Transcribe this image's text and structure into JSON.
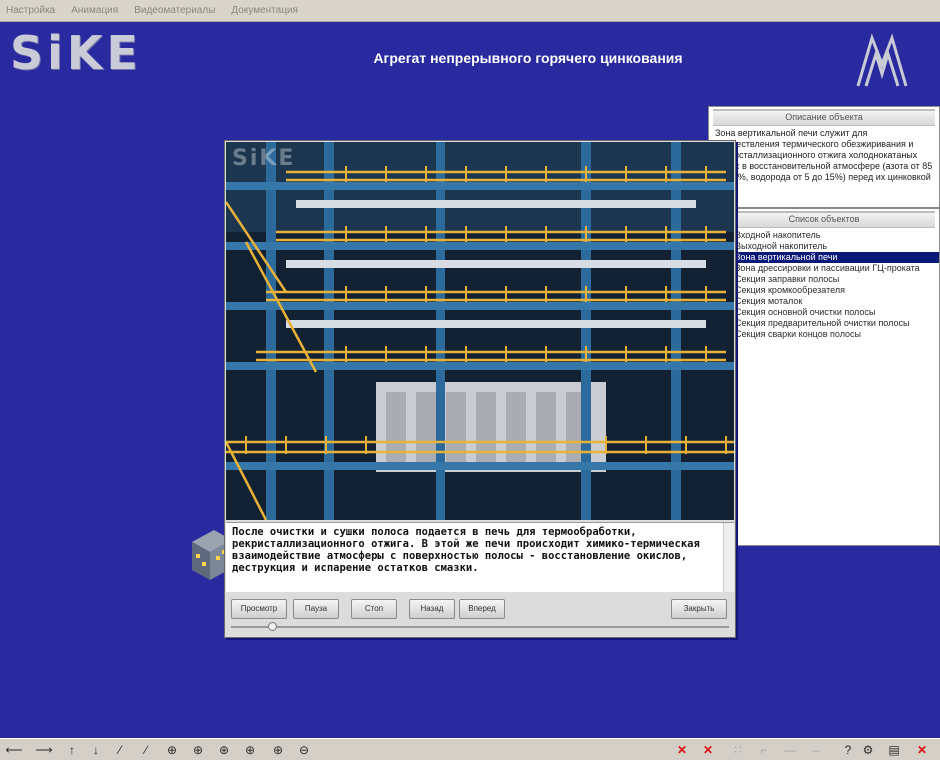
{
  "menu": [
    "Настройка",
    "Анимация",
    "Видеоматериалы",
    "Документация"
  ],
  "header": {
    "logo_text": "SiKE",
    "title": "Агрегат непрерывного горячего цинкования",
    "brand_mark": "MM"
  },
  "description_panel": {
    "title": "Описание объекта",
    "text": "Зона вертикальной печи служит для осуществления термического обезжиривания и рекристаллизационного отжига холоднокатаных полос в восстановительной атмосфере (азота от 85 до 95%, водорода от 5 до 15%) перед их цинковкой"
  },
  "objects_panel": {
    "title": "Список объектов",
    "items": [
      "Входной накопитель",
      "Выходной накопитель",
      "Зона вертикальной печи",
      "Зона дрессировки и пассивации ГЦ-проката",
      "Секция заправки полосы",
      "Секция кромкообрезателя",
      "Секция моталок",
      "Секция основной очистки полосы",
      "Секция предварительной очистки полосы",
      "Секция сварки концов полосы"
    ],
    "selected_index": 2
  },
  "viewer": {
    "watermark": "SiKE",
    "caption": "После очистки и сушки полоса подается в печь для термообработки, рекристаллизационного отжига. В этой же печи происходит химико-термическая взаимодействие атмосферы с поверхностью полосы - восстановление окислов, деструкция и испарение остатков смазки.",
    "buttons": {
      "view": "Просмотр",
      "pause": "Пауза",
      "stop": "Стоп",
      "back": "Назад",
      "forward": "Вперед",
      "close": "Закрыть"
    },
    "progress_fraction": 0.08
  },
  "toolbar": {
    "icons": [
      "arrow-left-icon",
      "arrow-right-icon",
      "arrow-up-icon",
      "arrow-down-icon",
      "diagonal-up-icon",
      "diagonal-down-icon",
      "rotate-x-icon",
      "rotate-y-icon",
      "rotate-z-icon",
      "rotate-free-icon",
      "zoom-in-icon",
      "zoom-out-icon",
      "remove-icon",
      "remove-all-icon",
      "grid-icon",
      "link-icon",
      "line-icon",
      "dash-icon",
      "help-icon",
      "settings-icon",
      "document-icon",
      "exit-icon"
    ]
  }
}
